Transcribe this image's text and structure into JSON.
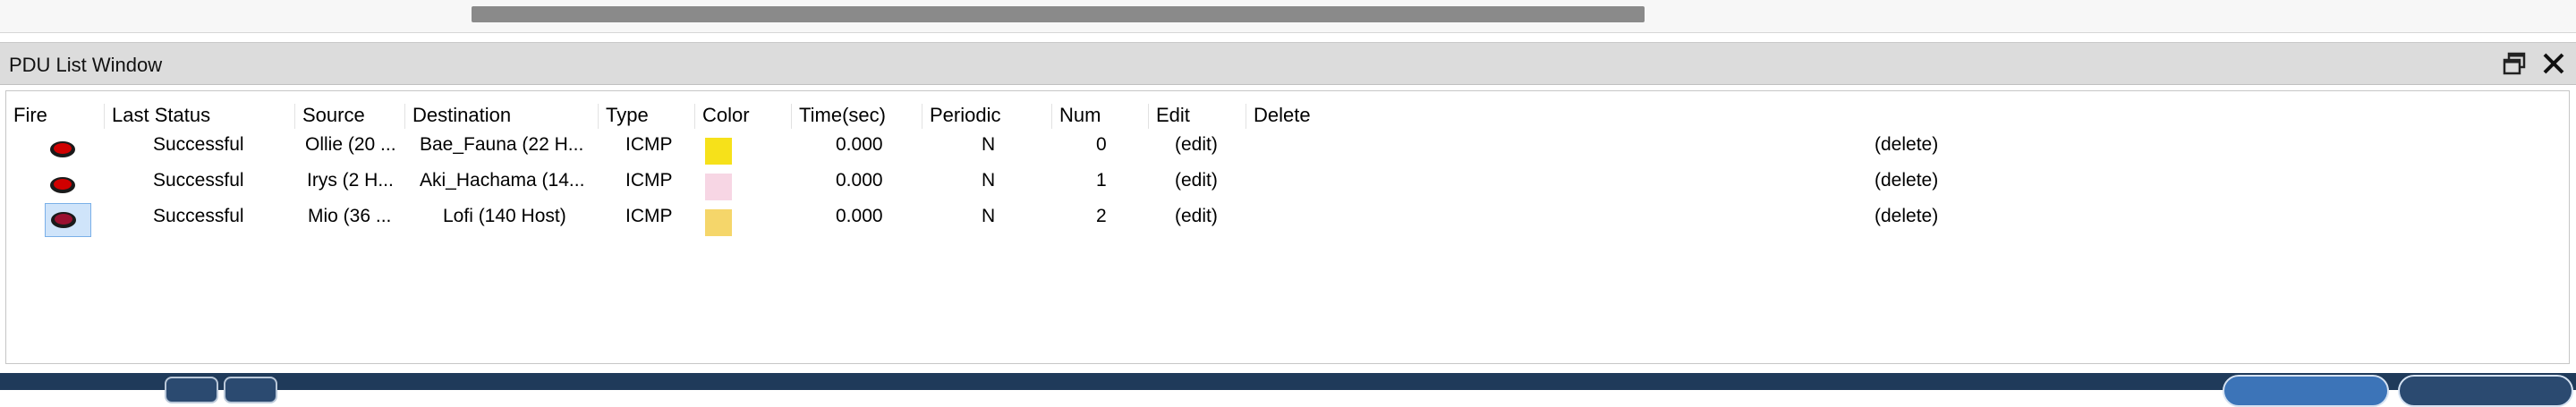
{
  "window": {
    "title": "PDU List Window"
  },
  "table": {
    "headers": [
      "Fire",
      "Last Status",
      "Source",
      "Destination",
      "Type",
      "Color",
      "Time(sec)",
      "Periodic",
      "Num",
      "Edit",
      "Delete"
    ],
    "rows": [
      {
        "last_status": "Successful",
        "source": "Ollie (20 ...",
        "destination": "Bae_Fauna (22 H...",
        "type": "ICMP",
        "color": "#f6e11a",
        "time": "0.000",
        "periodic": "N",
        "num": "0",
        "edit": "(edit)",
        "delete": "(delete)"
      },
      {
        "last_status": "Successful",
        "source": "Irys (2 H...",
        "destination": "Aki_Hachama (14...",
        "type": "ICMP",
        "color": "#f7d6e4",
        "time": "0.000",
        "periodic": "N",
        "num": "1",
        "edit": "(edit)",
        "delete": "(delete)"
      },
      {
        "last_status": "Successful",
        "source": "Mio (36 ...",
        "destination": "Lofi (140 Host)",
        "type": "ICMP",
        "color": "#f5d66a",
        "time": "0.000",
        "periodic": "N",
        "num": "2",
        "edit": "(edit)",
        "delete": "(delete)"
      }
    ]
  },
  "icons": {
    "fire": "fire-pdu-icon",
    "restore": "restore-window-icon",
    "close": "close-icon"
  }
}
